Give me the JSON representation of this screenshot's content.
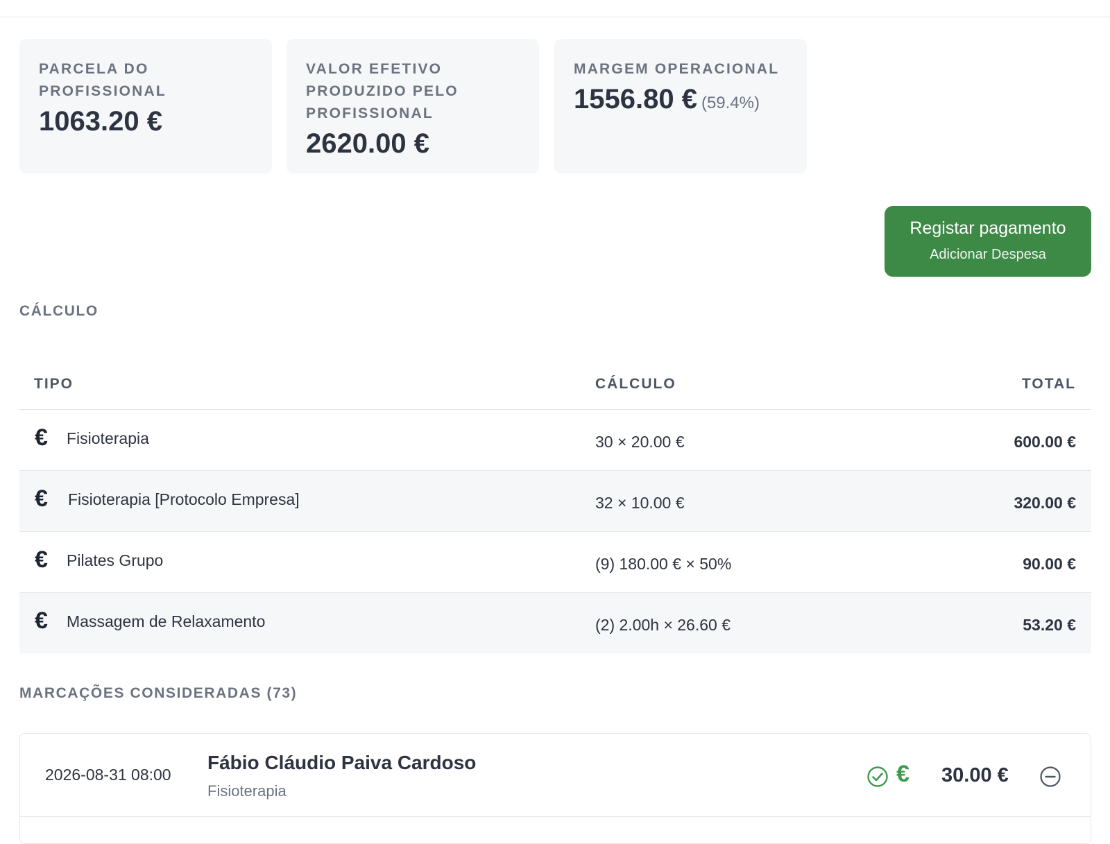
{
  "summary": {
    "cards": [
      {
        "label": "PARCELA DO PROFISSIONAL",
        "value": "1063.20 €"
      },
      {
        "label": "VALOR EFETIVO PRODUZIDO PELO PROFISSIONAL",
        "value": "2620.00 €"
      },
      {
        "label": "MARGEM OPERACIONAL",
        "value": "1556.80 €",
        "percent": "(59.4%)"
      }
    ]
  },
  "actions": {
    "pay_button": {
      "label": "Registar pagamento",
      "sublabel": "Adicionar Despesa"
    }
  },
  "calculation": {
    "title": "CÁLCULO",
    "headers": {
      "tipo": "TIPO",
      "calculo": "CÁLCULO",
      "total": "TOTAL"
    },
    "rows": [
      {
        "icon": "euro-icon",
        "tipo": "Fisioterapia",
        "calculo": "30 × 20.00 €",
        "total": "600.00 €"
      },
      {
        "icon": "euro-icon",
        "tipo": "Fisioterapia [Protocolo Empresa]",
        "calculo": "32 × 10.00 €",
        "total": "320.00 €"
      },
      {
        "icon": "euro-icon",
        "tipo": "Pilates Grupo",
        "calculo": "(9) 180.00 € × 50%",
        "total": "90.00 €"
      },
      {
        "icon": "euro-icon",
        "tipo": "Massagem de Relaxamento",
        "calculo": "(2) 2.00h × 26.60 €",
        "total": "53.20 €"
      }
    ]
  },
  "appointments": {
    "title": "MARCAÇÕES CONSIDERADAS (73)",
    "items": [
      {
        "datetime": "2026-08-31 08:00",
        "client": "Fábio Cláudio Paiva Cardoso",
        "service": "Fisioterapia",
        "amount": "30.00 €",
        "status_icons": [
          "check-circle-icon",
          "euro-icon"
        ]
      }
    ]
  },
  "colors": {
    "accent_green": "#3d8a46",
    "card_bg": "#f5f7f9",
    "muted_text": "#6b7280"
  }
}
